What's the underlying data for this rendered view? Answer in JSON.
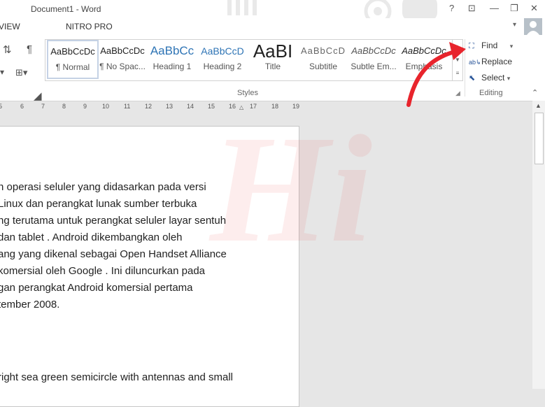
{
  "window": {
    "title": "Document1 - Word",
    "help": "?",
    "ribbon_display": "⊡",
    "minimize": "—",
    "restore": "❐",
    "close": "✕"
  },
  "menu": {
    "tabs": [
      "VIEW",
      "NITRO PRO"
    ],
    "collapse": "▾"
  },
  "styles": {
    "group_label": "Styles",
    "items": [
      {
        "preview": "AaBbCcDc",
        "name": "¶ Normal"
      },
      {
        "preview": "AaBbCcDc",
        "name": "¶ No Spac..."
      },
      {
        "preview": "AaBbCc",
        "name": "Heading 1"
      },
      {
        "preview": "AaBbCcD",
        "name": "Heading 2"
      },
      {
        "preview": "AaBI",
        "name": "Title"
      },
      {
        "preview": "AaBbCcD",
        "name": "Subtitle"
      },
      {
        "preview": "AaBbCcDc",
        "name": "Subtle Em..."
      },
      {
        "preview": "AaBbCcDc",
        "name": "Emphasis"
      }
    ]
  },
  "editing": {
    "group_label": "Editing",
    "find": "Find",
    "find_arrow": "▾",
    "replace": "Replace",
    "select": "Select",
    "select_arrow": "▾",
    "find_icon": "binoculars-icon",
    "replace_icon": "replace-icon",
    "select_icon": "cursor-icon"
  },
  "ruler": {
    "ticks": [
      "5",
      "6",
      "7",
      "8",
      "9",
      "10",
      "11",
      "12",
      "13",
      "14",
      "15",
      "16",
      "17",
      "18",
      "19"
    ]
  },
  "document": {
    "lines": [
      "n operasi seluler yang didasarkan pada versi",
      " Linux dan perangkat lunak sumber terbuka",
      "ng terutama untuk perangkat seluler layar sentuh",
      " dan tablet . Android dikembangkan oleh",
      "ang yang dikenal sebagai Open Handset Alliance",
      " komersial oleh Google . Ini diluncurkan pada",
      "gan perangkat Android komersial pertama",
      "tember 2008.",
      "right sea green semicircle with antennas and small"
    ]
  },
  "watermark": "Hi",
  "colors": {
    "annotation_arrow": "#e8242c",
    "accent": "#2b579a",
    "spell_error": "#dd2222"
  }
}
